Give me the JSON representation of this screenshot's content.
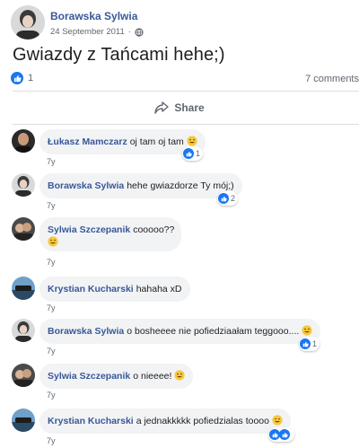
{
  "post": {
    "author": "Borawska Sylwia",
    "date": "24 September 2011",
    "separator": "·",
    "text": "Gwiazdy z Tańcami hehe;)",
    "reaction_count": "1",
    "comment_count": "7 comments",
    "share_label": "Share"
  },
  "icons": {
    "like": "like-icon",
    "globe": "globe-icon",
    "share": "share-arrow-icon",
    "emoji": "grinning-face-emoji"
  },
  "colors": {
    "link": "#385898",
    "accent": "#1877f2",
    "bubble": "#f2f3f5",
    "meta": "#606770",
    "emoji": "#f7c93d"
  },
  "comments": [
    {
      "author": "Łukasz Mamczarz",
      "text": "oj tam oj tam",
      "emoji": true,
      "time": "7y",
      "likes": "1"
    },
    {
      "author": "Borawska Sylwia",
      "text": "hehe gwiazdorze Ty mój;)",
      "emoji": false,
      "time": "7y",
      "likes": "2"
    },
    {
      "author": "Sylwia Szczepanik",
      "text": "cooooo??",
      "emoji": true,
      "time": "7y",
      "likes": ""
    },
    {
      "author": "Krystian Kucharski",
      "text": "hahaha xD",
      "emoji": false,
      "time": "7y",
      "likes": ""
    },
    {
      "author": "Borawska Sylwia",
      "text": "o bosheeee nie pofiedziaałam teggooo....",
      "emoji": true,
      "time": "7y",
      "likes": "1"
    },
    {
      "author": "Sylwia Szczepanik",
      "text": "o nieeee!",
      "emoji": true,
      "time": "7y",
      "likes": ""
    },
    {
      "author": "Krystian Kucharski",
      "text": "a jednakkkkk pofiedzialas toooo",
      "emoji": true,
      "time": "7y",
      "likes": ""
    }
  ]
}
